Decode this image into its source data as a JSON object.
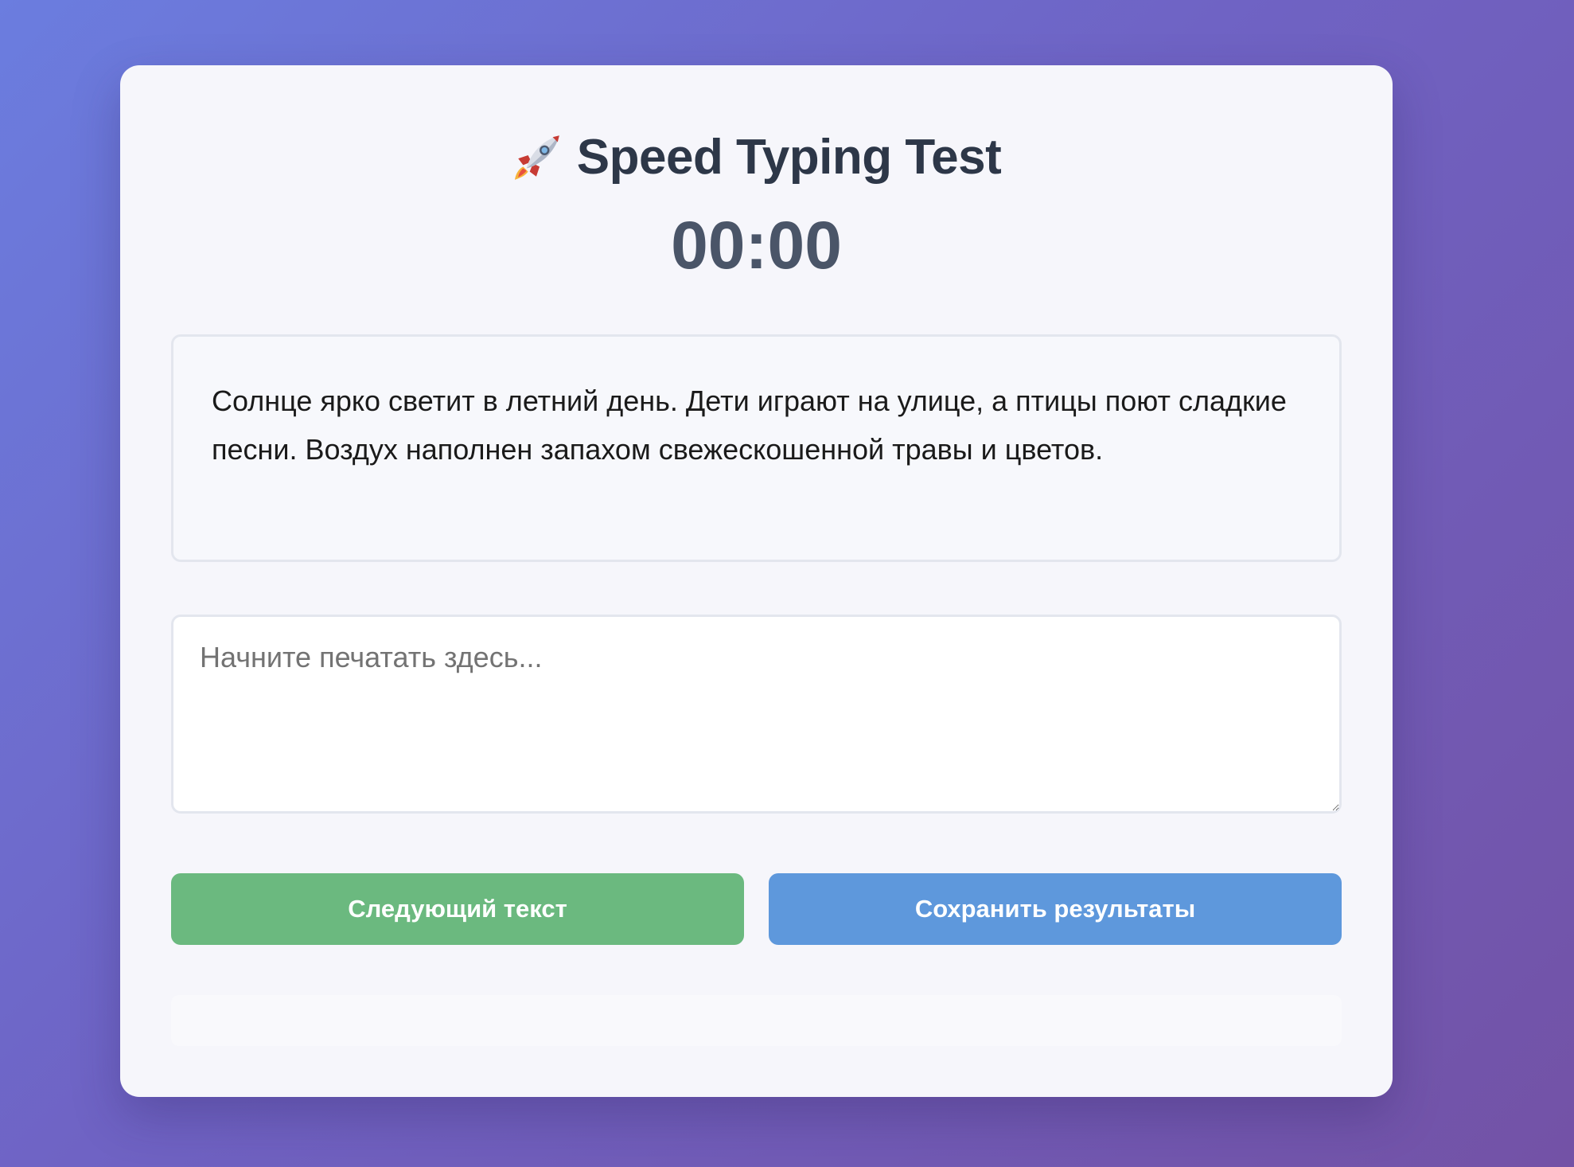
{
  "header": {
    "icon": "rocket-icon",
    "title": "Speed Typing Test"
  },
  "timer": {
    "value": "00:00"
  },
  "text_display": {
    "text": "Солнце ярко светит в летний день. Дети играют на улице, а птицы поют сладкие песни. Воздух наполнен запахом свежескошенной травы и цветов."
  },
  "input": {
    "value": "",
    "placeholder": "Начните печатать здесь..."
  },
  "buttons": {
    "next_label": "Следующий текст",
    "save_label": "Сохранить результаты"
  },
  "colors": {
    "next_button": "#6bb97f",
    "save_button": "#5e98dc",
    "title_text": "#2d3748",
    "timer_text": "#4a5568"
  }
}
